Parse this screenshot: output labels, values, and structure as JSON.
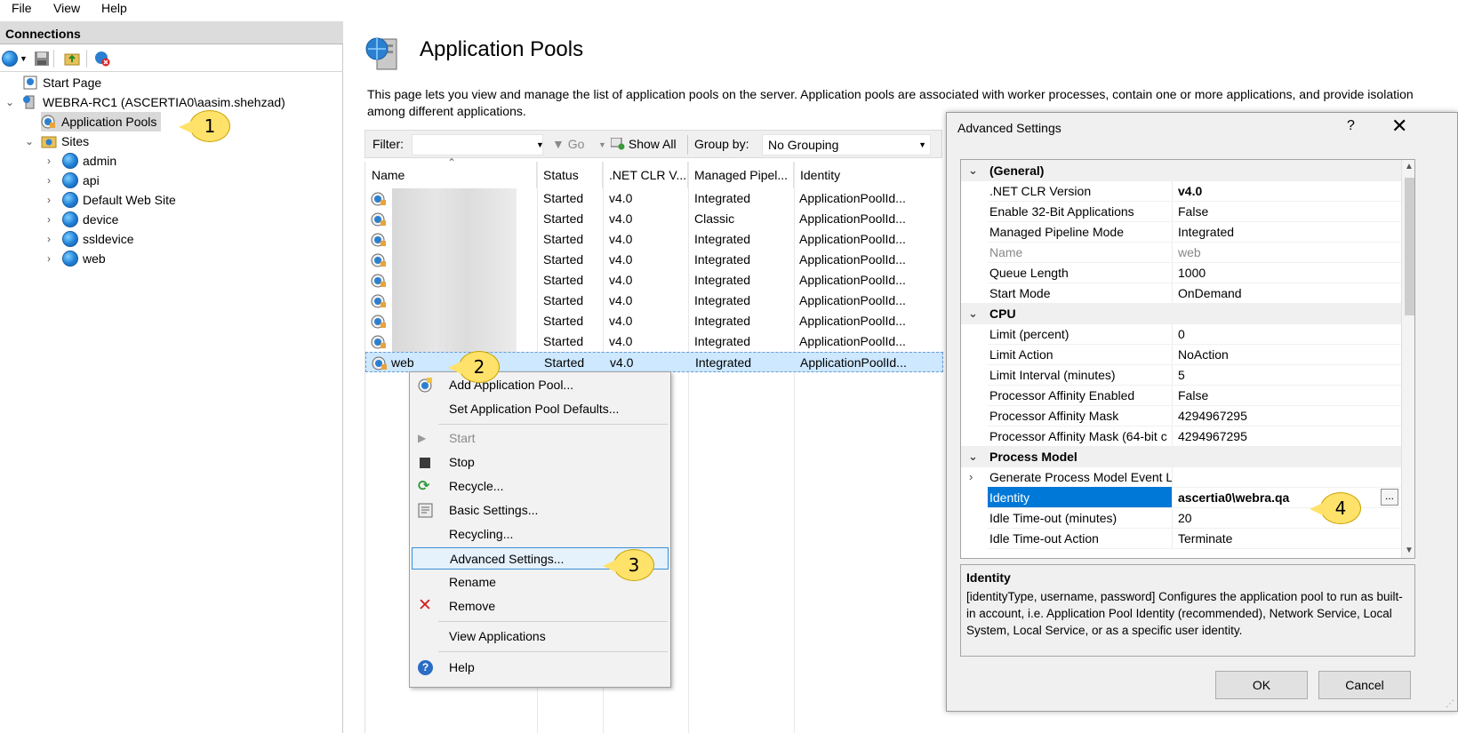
{
  "menu": {
    "file": "File",
    "view": "View",
    "help": "Help"
  },
  "connections": {
    "header": "Connections",
    "tree": {
      "start_page": "Start Page",
      "server": "WEBRA-RC1 (ASCERTIA0\\aasim.shehzad)",
      "app_pools": "Application Pools",
      "sites": "Sites",
      "site_items": [
        "admin",
        "api",
        "Default Web Site",
        "device",
        "ssldevice",
        "web"
      ]
    }
  },
  "page": {
    "title": "Application Pools",
    "description": "This page lets you view and manage the list of application pools on the server. Application pools are associated with worker processes, contain one or more applications, and provide isolation among different applications."
  },
  "filterbar": {
    "filter_label": "Filter:",
    "go": "Go",
    "show_all": "Show All",
    "group_by_label": "Group by:",
    "group_by_value": "No Grouping"
  },
  "grid": {
    "columns": [
      "Name",
      "Status",
      ".NET CLR V...",
      "Managed Pipel...",
      "Identity"
    ],
    "rows": [
      {
        "name": "",
        "status": "Started",
        "clr": "v4.0",
        "pipeline": "Integrated",
        "identity": "ApplicationPoolId..."
      },
      {
        "name": "",
        "status": "Started",
        "clr": "v4.0",
        "pipeline": "Classic",
        "identity": "ApplicationPoolId..."
      },
      {
        "name": "",
        "status": "Started",
        "clr": "v4.0",
        "pipeline": "Integrated",
        "identity": "ApplicationPoolId..."
      },
      {
        "name": "",
        "status": "Started",
        "clr": "v4.0",
        "pipeline": "Integrated",
        "identity": "ApplicationPoolId..."
      },
      {
        "name": "",
        "status": "Started",
        "clr": "v4.0",
        "pipeline": "Integrated",
        "identity": "ApplicationPoolId..."
      },
      {
        "name": "",
        "status": "Started",
        "clr": "v4.0",
        "pipeline": "Integrated",
        "identity": "ApplicationPoolId..."
      },
      {
        "name": "",
        "status": "Started",
        "clr": "v4.0",
        "pipeline": "Integrated",
        "identity": "ApplicationPoolId..."
      },
      {
        "name": "",
        "status": "Started",
        "clr": "v4.0",
        "pipeline": "Integrated",
        "identity": "ApplicationPoolId..."
      },
      {
        "name": "web",
        "status": "Started",
        "clr": "v4.0",
        "pipeline": "Integrated",
        "identity": "ApplicationPoolId..."
      }
    ]
  },
  "context_menu": {
    "add_pool": "Add Application Pool...",
    "set_defaults": "Set Application Pool Defaults...",
    "start": "Start",
    "stop": "Stop",
    "recycle": "Recycle...",
    "basic_settings": "Basic Settings...",
    "recycling": "Recycling...",
    "advanced_settings": "Advanced Settings...",
    "rename": "Rename",
    "remove": "Remove",
    "view_applications": "View Applications",
    "help": "Help"
  },
  "callouts": [
    "1",
    "2",
    "3",
    "4"
  ],
  "dialog": {
    "title": "Advanced Settings",
    "help_glyph": "?",
    "close_glyph": "✕",
    "categories": {
      "general": "(General)",
      "cpu": "CPU",
      "process_model": "Process Model"
    },
    "general": [
      {
        "name": ".NET CLR Version",
        "value": "v4.0"
      },
      {
        "name": "Enable 32-Bit Applications",
        "value": "False"
      },
      {
        "name": "Managed Pipeline Mode",
        "value": "Integrated"
      },
      {
        "name": "Name",
        "value": "web"
      },
      {
        "name": "Queue Length",
        "value": "1000"
      },
      {
        "name": "Start Mode",
        "value": "OnDemand"
      }
    ],
    "cpu": [
      {
        "name": "Limit (percent)",
        "value": "0"
      },
      {
        "name": "Limit Action",
        "value": "NoAction"
      },
      {
        "name": "Limit Interval (minutes)",
        "value": "5"
      },
      {
        "name": "Processor Affinity Enabled",
        "value": "False"
      },
      {
        "name": "Processor Affinity Mask",
        "value": "4294967295"
      },
      {
        "name": "Processor Affinity Mask (64-bit c",
        "value": "4294967295"
      }
    ],
    "process_model": [
      {
        "name": "Generate Process Model Event L",
        "value": ""
      },
      {
        "name": "Identity",
        "value": "ascertia0\\webra.qa"
      },
      {
        "name": "Idle Time-out (minutes)",
        "value": "20"
      },
      {
        "name": "Idle Time-out Action",
        "value": "Terminate"
      }
    ],
    "ellipsis": "...",
    "desc_title": "Identity",
    "desc_text": "[identityType, username, password] Configures the application pool to run as built-in account, i.e. Application Pool Identity (recommended), Network Service, Local System, Local Service, or as a specific user identity.",
    "ok": "OK",
    "cancel": "Cancel"
  }
}
